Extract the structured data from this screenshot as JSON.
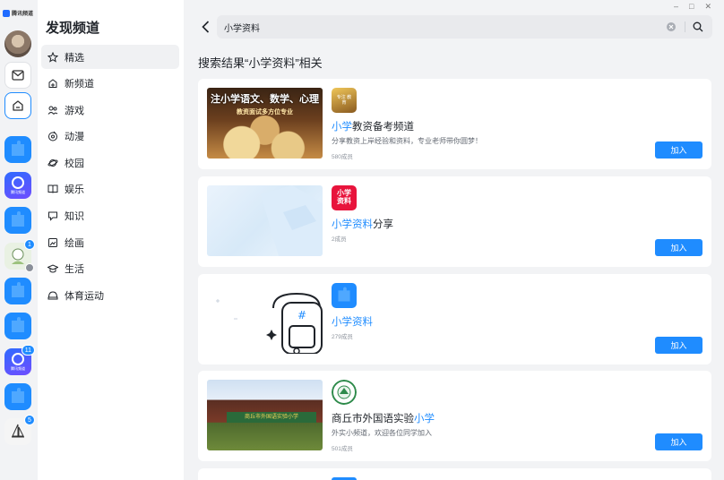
{
  "brand": {
    "name": "腾讯频道"
  },
  "rail": {
    "badges": [
      "1",
      "11",
      "5"
    ]
  },
  "sidebar": {
    "title": "发现频道",
    "items": [
      {
        "label": "精选",
        "icon": "star-icon",
        "selected": true
      },
      {
        "label": "新频道",
        "icon": "new-channel-icon"
      },
      {
        "label": "游戏",
        "icon": "gamepad-icon"
      },
      {
        "label": "动漫",
        "icon": "anime-icon"
      },
      {
        "label": "校园",
        "icon": "planet-icon"
      },
      {
        "label": "娱乐",
        "icon": "book-icon"
      },
      {
        "label": "知识",
        "icon": "chat-bubble-icon"
      },
      {
        "label": "绘画",
        "icon": "painting-icon"
      },
      {
        "label": "生活",
        "icon": "graduation-cap-icon"
      },
      {
        "label": "体育运动",
        "icon": "helmet-icon"
      }
    ]
  },
  "search": {
    "value": "小学资料"
  },
  "results": {
    "heading": "搜索结果“小学资料”相关",
    "join_label": "加入",
    "items": [
      {
        "name_hl": "小学",
        "name_rest": "教资备考频道",
        "description": "分享教资上岸经验和资料，专业老师带你圆梦！",
        "members": "580成员",
        "cover_text_1": "注小学语文、数学、心理",
        "cover_text_2": "教资面试多方位专业",
        "icon_text": "专注 教育"
      },
      {
        "name_hl": "小学资料",
        "name_rest": "分享",
        "description": "",
        "members": "2成员",
        "icon_text_1": "小学",
        "icon_text_2": "资料"
      },
      {
        "name_hl": "小学资料",
        "name_rest": "",
        "description": "",
        "members": "279成员"
      },
      {
        "name_pre": "商丘市外国语实验",
        "name_hl": "小学",
        "description": "外实小频道，欢迎各位同学加入",
        "members": "501成员",
        "cover_sign": "商丘市外国语实验小学"
      }
    ]
  },
  "colors": {
    "accent": "#1f8cff",
    "background": "#f2f3f5",
    "card": "#ffffff"
  }
}
